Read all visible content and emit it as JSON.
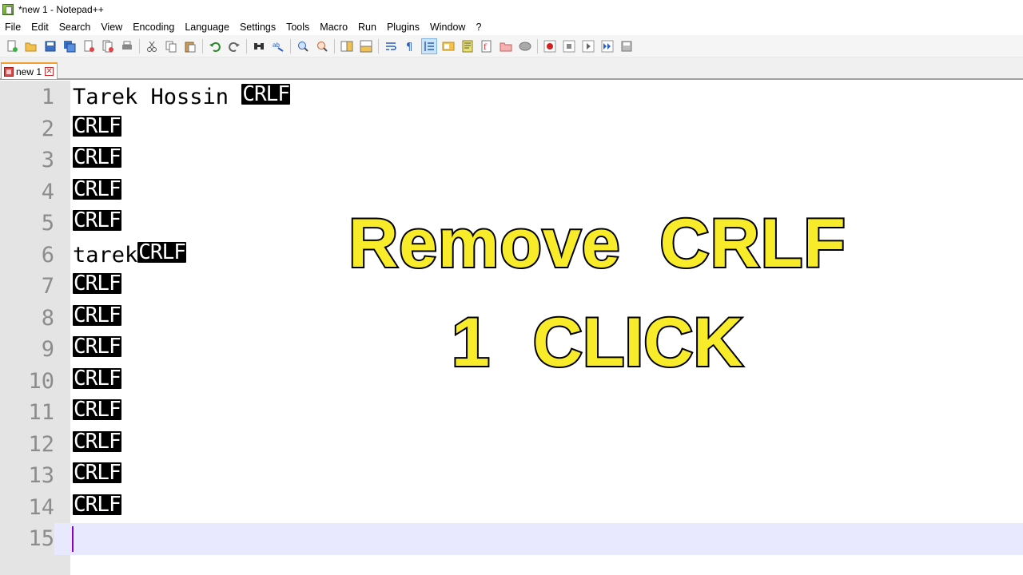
{
  "window": {
    "title": "*new 1 - Notepad++"
  },
  "menu": [
    "File",
    "Edit",
    "Search",
    "View",
    "Encoding",
    "Language",
    "Settings",
    "Tools",
    "Macro",
    "Run",
    "Plugins",
    "Window",
    "?"
  ],
  "tabs": [
    {
      "label": "new 1",
      "active": true,
      "modified": true
    }
  ],
  "editor": {
    "lines": [
      {
        "number": "1",
        "text": "Tarek Hossin ",
        "eol": "CRLF"
      },
      {
        "number": "2",
        "text": "",
        "eol": "CRLF"
      },
      {
        "number": "3",
        "text": "",
        "eol": "CRLF"
      },
      {
        "number": "4",
        "text": "",
        "eol": "CRLF"
      },
      {
        "number": "5",
        "text": "",
        "eol": "CRLF"
      },
      {
        "number": "6",
        "text": "tarek",
        "eol": "CRLF"
      },
      {
        "number": "7",
        "text": "",
        "eol": "CRLF"
      },
      {
        "number": "8",
        "text": "",
        "eol": "CRLF"
      },
      {
        "number": "9",
        "text": "",
        "eol": "CRLF"
      },
      {
        "number": "10",
        "text": "",
        "eol": "CRLF"
      },
      {
        "number": "11",
        "text": "",
        "eol": "CRLF"
      },
      {
        "number": "12",
        "text": "",
        "eol": "CRLF"
      },
      {
        "number": "13",
        "text": "",
        "eol": "CRLF"
      },
      {
        "number": "14",
        "text": "",
        "eol": "CRLF"
      },
      {
        "number": "15",
        "text": "",
        "eol": "",
        "current": true
      }
    ]
  },
  "overlay": {
    "line1": "Remove CRLF",
    "line2": "1 CLICK"
  },
  "colors": {
    "overlay_text": "#f8ec2a",
    "overlay_outline": "#000000",
    "current_line": "#e8e8ff",
    "gutter": "#e4e4e4",
    "caret": "#8a00c8"
  },
  "toolbar_icons": [
    "new-file-icon",
    "open-file-icon",
    "save-icon",
    "save-all-icon",
    "close-icon",
    "close-all-icon",
    "print-icon",
    "|",
    "cut-icon",
    "copy-icon",
    "paste-icon",
    "|",
    "undo-icon",
    "redo-icon",
    "|",
    "find-icon",
    "replace-icon",
    "|",
    "zoom-in-icon",
    "zoom-out-icon",
    "|",
    "sync-vertical-icon",
    "sync-horizontal-icon",
    "|",
    "word-wrap-icon",
    "show-all-characters-icon",
    "indent-guide-icon",
    "user-language-icon",
    "document-map-icon",
    "function-list-icon",
    "folder-workspace-icon",
    "monitoring-icon",
    "|",
    "record-macro-icon",
    "stop-macro-icon",
    "play-macro-icon",
    "run-macro-multiple-icon",
    "save-macro-icon"
  ]
}
